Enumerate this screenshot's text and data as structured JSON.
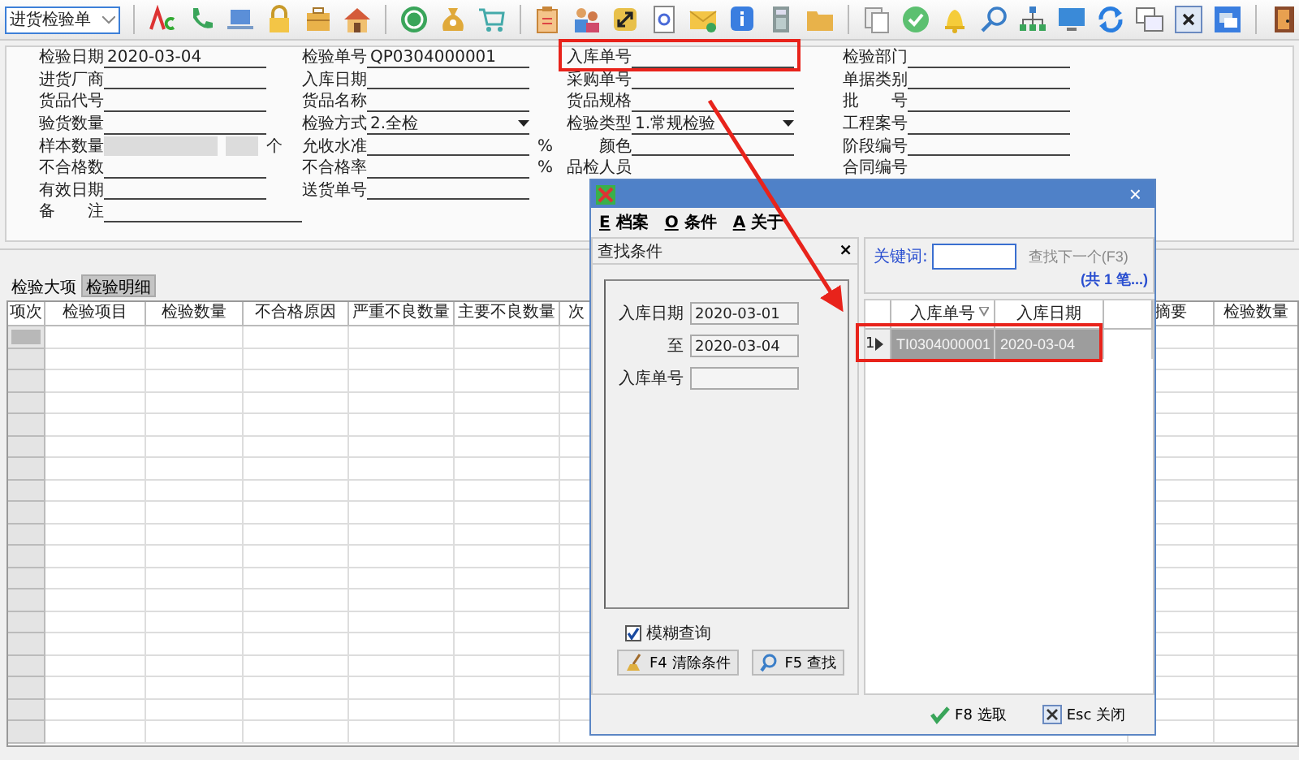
{
  "toolbar": {
    "document_type": "进货检验单"
  },
  "form": {
    "rows": [
      [
        {
          "kind": "text",
          "label": "检验日期",
          "value": "2020-03-04"
        },
        {
          "kind": "text",
          "label": "检验单号",
          "value": "QP0304000001"
        },
        {
          "kind": "text",
          "label": "入库单号"
        },
        {
          "kind": "text",
          "label": "检验部门"
        }
      ],
      [
        {
          "kind": "text",
          "label": "进货厂商"
        },
        {
          "kind": "text",
          "label": "入库日期"
        },
        {
          "kind": "text",
          "label": "采购单号"
        },
        {
          "kind": "text",
          "label": "单据类别"
        }
      ],
      [
        {
          "kind": "text",
          "label": "货品代号"
        },
        {
          "kind": "text",
          "label": "货品名称"
        },
        {
          "kind": "text",
          "label": "货品规格"
        },
        {
          "kind": "text",
          "label": "批 号"
        }
      ],
      [
        {
          "kind": "text",
          "label": "验货数量"
        },
        {
          "kind": "dropdown",
          "label": "检验方式",
          "value": "2.全检"
        },
        {
          "kind": "dropdown",
          "label": "检验类型",
          "value": "1.常规检验"
        },
        {
          "kind": "text",
          "label": "工程案号"
        }
      ],
      [
        {
          "kind": "sample",
          "label": "样本数量",
          "unit": "个"
        },
        {
          "kind": "percent",
          "label": "允收水准",
          "unit": "%"
        },
        {
          "kind": "text",
          "label": "颜色"
        },
        {
          "kind": "text",
          "label": "阶段编号"
        }
      ],
      [
        {
          "kind": "text",
          "label": "不合格数"
        },
        {
          "kind": "percent",
          "label": "不合格率",
          "unit": "%"
        },
        {
          "kind": "label",
          "label": "品检人员"
        },
        {
          "kind": "label",
          "label": "合同编号"
        }
      ],
      [
        {
          "kind": "text",
          "label": "有效日期"
        },
        {
          "kind": "text",
          "label": "送货单号"
        }
      ],
      [
        {
          "kind": "wide",
          "label": "备 注"
        }
      ]
    ]
  },
  "detail_tabs": [
    {
      "label": "检验大项",
      "selected": false
    },
    {
      "label": "检验明细",
      "selected": true
    }
  ],
  "grid": {
    "columns": [
      "项次",
      "检验项目",
      "检验数量",
      "不合格原因",
      "严重不良数量",
      "主要不良数量",
      "次",
      "摘要",
      "检验数量"
    ],
    "rows": [
      {
        "selected": true
      },
      {
        "selected": false
      },
      {
        "selected": false
      },
      {
        "selected": false
      },
      {
        "selected": false
      },
      {
        "selected": false
      },
      {
        "selected": false
      },
      {
        "selected": false
      },
      {
        "selected": false
      },
      {
        "selected": false
      },
      {
        "selected": false
      },
      {
        "selected": false
      },
      {
        "selected": false
      },
      {
        "selected": false
      },
      {
        "selected": false
      },
      {
        "selected": false
      },
      {
        "selected": false
      },
      {
        "selected": false
      },
      {
        "selected": false
      }
    ]
  },
  "dialog": {
    "close": "×",
    "menu": [
      {
        "key": "E",
        "label": "档案"
      },
      {
        "key": "O",
        "label": "条件"
      },
      {
        "key": "A",
        "label": "关于"
      }
    ],
    "criteria": {
      "title": "查找条件",
      "close": "×",
      "fields": [
        {
          "label": "入库日期",
          "value": "2020-03-01"
        },
        {
          "label": "至",
          "value": "2020-03-04"
        },
        {
          "label": "入库单号"
        }
      ],
      "fuzzy": {
        "label": "模糊查询",
        "checked": true
      },
      "buttons": [
        {
          "kind": "clear",
          "label": "F4 清除条件"
        },
        {
          "kind": "find",
          "label": "F5 查找"
        }
      ]
    },
    "search": {
      "label": "关键词:",
      "find_next": "查找下一个(F3)",
      "count": "(共 1 笔...)"
    },
    "results": {
      "columns": [
        "入库单号",
        "入库日期"
      ],
      "rows": [
        {
          "number": "1",
          "cells": [
            "TI0304000001",
            "2020-03-04"
          ],
          "selected": true
        }
      ]
    },
    "buttons": [
      {
        "kind": "select",
        "label": "F8 选取"
      },
      {
        "kind": "close",
        "label": "Esc 关闭"
      }
    ]
  }
}
